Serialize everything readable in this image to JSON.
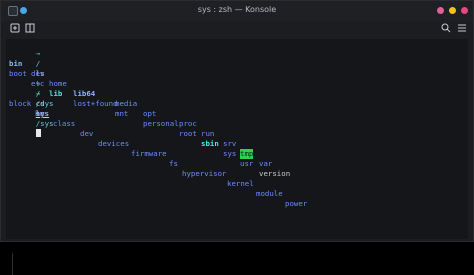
{
  "window": {
    "title": "sys : zsh — Konsole"
  },
  "colors": {
    "close": "#e64980",
    "minimize": "#f0c419",
    "maximize": "#e0609a",
    "menu_dot": "#49a7e8",
    "prompt_arrow": "#4fe08a",
    "cwd": "#5ad0e8",
    "directory": "#6b8cff",
    "symlink": "#4ee6e0",
    "tmp_bg": "#30d050"
  },
  "icons": {
    "app": "konsole-app-icon",
    "menu": "round-menu-icon",
    "new_tab": "new-tab-icon",
    "split": "split-view-icon",
    "search": "search-icon",
    "hamburger": "hamburger-menu-icon"
  },
  "terminal": {
    "lines": [
      {
        "prompt": "→",
        "cwd": "/",
        "command": "ls"
      },
      {
        "entries": [
          "bin",
          "dev",
          "home",
          "lib64",
          "media",
          "opt",
          "proc",
          "run",
          "srv",
          "tmp",
          "var"
        ]
      },
      {
        "entries": [
          "boot",
          "etc",
          "lib",
          "lost+found",
          "mnt",
          "personal",
          "root",
          "sbin",
          "sys",
          "usr",
          "version"
        ]
      },
      {
        "prompt": "→",
        "cwd": "/",
        "command": "cd",
        "arg": "sys"
      },
      {
        "prompt": "→",
        "cwd": "/sys",
        "command": "ls"
      },
      {
        "entries": [
          "block",
          "bus",
          "class",
          "dev",
          "devices",
          "firmware",
          "fs",
          "hypervisor",
          "kernel",
          "module",
          "power"
        ]
      },
      {
        "prompt": "→",
        "cwd": "/sys",
        "command": ""
      }
    ]
  }
}
